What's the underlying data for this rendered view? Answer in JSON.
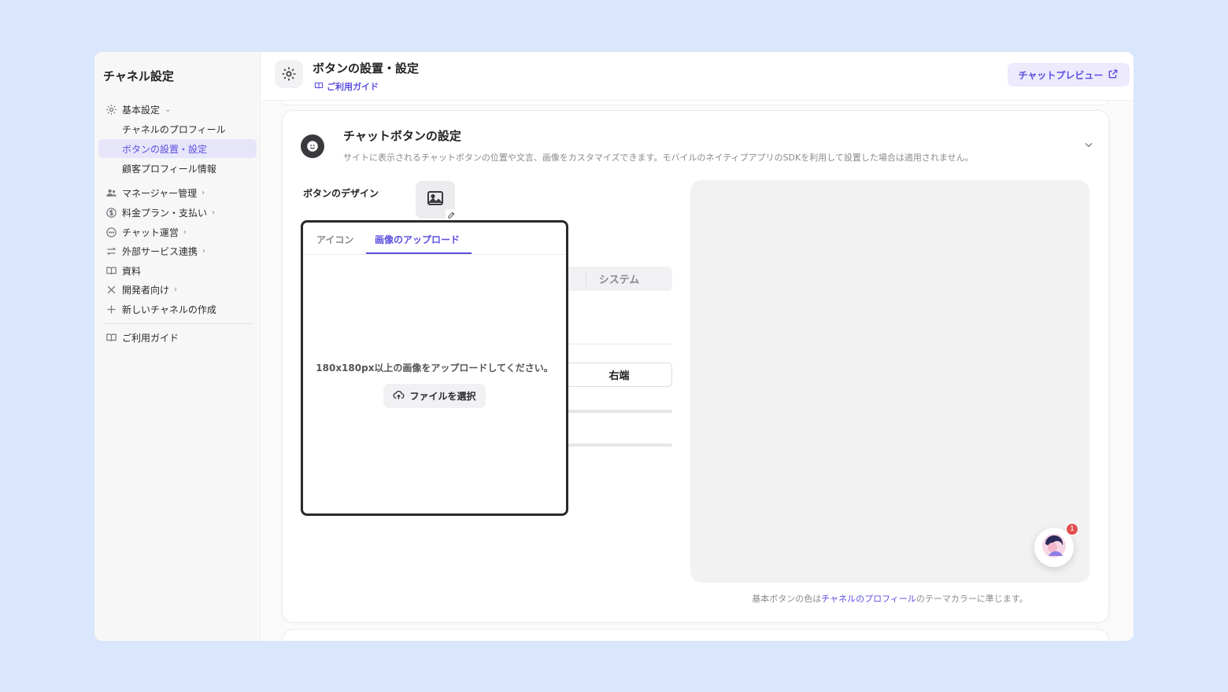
{
  "sidebar": {
    "title": "チャネル設定",
    "items": [
      {
        "label": "基本設定",
        "icon": "gear-icon"
      },
      {
        "label": "チャネルのプロフィール"
      },
      {
        "label": "ボタンの設置・設定"
      },
      {
        "label": "顧客プロフィール情報"
      },
      {
        "label": "マネージャー管理",
        "icon": "users-icon"
      },
      {
        "label": "料金プラン・支払い",
        "icon": "dollar-icon"
      },
      {
        "label": "チャット運営",
        "icon": "chat-icon"
      },
      {
        "label": "外部サービス連携",
        "icon": "swap-icon"
      },
      {
        "label": "資料",
        "icon": "book-icon"
      },
      {
        "label": "開発者向け",
        "icon": "tools-icon"
      },
      {
        "label": "新しいチャネルの作成",
        "icon": "plus-icon"
      },
      {
        "label": "ご利用ガイド",
        "icon": "book-icon"
      }
    ]
  },
  "header": {
    "title": "ボタンの設置・設定",
    "guide_link": "ご利用ガイド",
    "preview_button": "チャットプレビュー"
  },
  "card": {
    "title": "チャットボタンの設定",
    "description": "サイトに表示されるチャットボタンの位置や文言、画像をカスタマイズできます。モバイルのネイティブアプリのSDKを利用して設置した場合は適用されません。",
    "design_label": "ボタンのデザイン",
    "theme_option": "システム",
    "position_option": "右端"
  },
  "popover": {
    "tabs": [
      {
        "label": "アイコン",
        "active": false
      },
      {
        "label": "画像のアップロード",
        "active": true
      }
    ],
    "upload_message": "180x180px以上の画像をアップロードしてください。",
    "file_button": "ファイルを選択"
  },
  "preview": {
    "badge_count": "1",
    "note_prefix": "基本ボタンの色は",
    "note_link": "チャネルのプロフィール",
    "note_suffix": "のテーマカラーに準じます。"
  },
  "colors": {
    "accent": "#5b4fe0",
    "background": "#d9e6fb",
    "badge": "#e0504f"
  }
}
